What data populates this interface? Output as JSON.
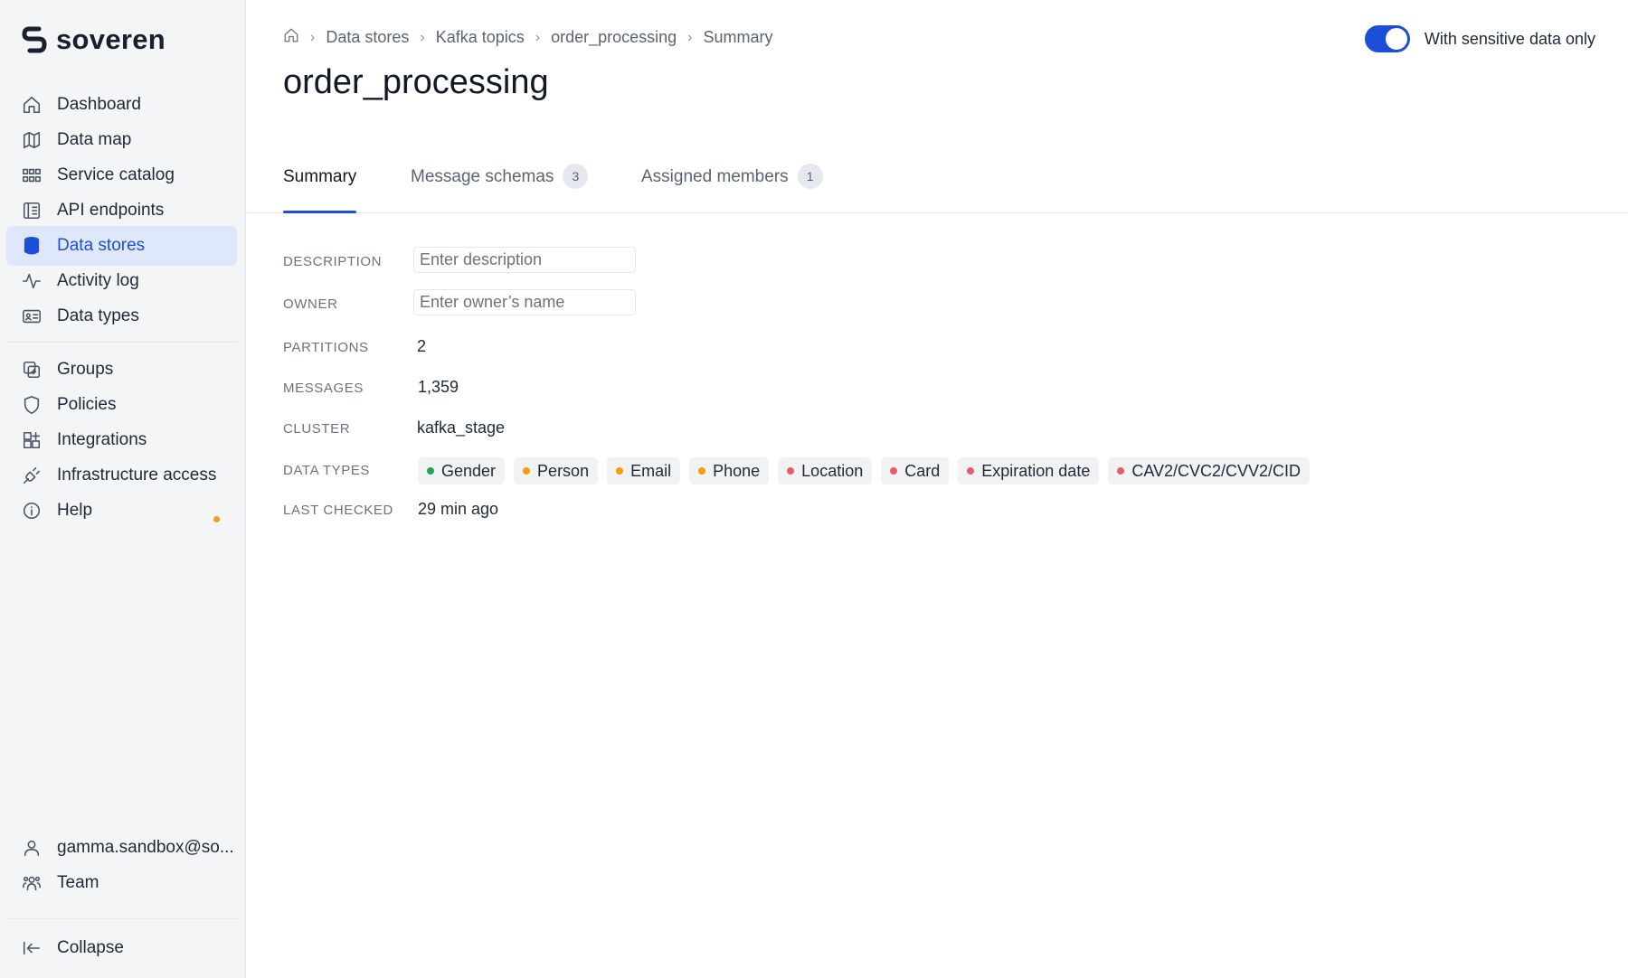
{
  "brand": {
    "name": "soveren"
  },
  "sidebar": {
    "items": [
      {
        "label": "Dashboard",
        "icon": "home-icon"
      },
      {
        "label": "Data map",
        "icon": "map-icon"
      },
      {
        "label": "Service catalog",
        "icon": "grid-icon"
      },
      {
        "label": "API endpoints",
        "icon": "api-icon"
      },
      {
        "label": "Data stores",
        "icon": "database-icon",
        "active": true
      },
      {
        "label": "Activity log",
        "icon": "activity-icon"
      },
      {
        "label": "Data types",
        "icon": "id-card-icon"
      },
      {
        "label": "Groups",
        "icon": "groups-icon"
      },
      {
        "label": "Policies",
        "icon": "shield-icon"
      },
      {
        "label": "Integrations",
        "icon": "integrations-icon"
      },
      {
        "label": "Infrastructure access",
        "icon": "plug-icon",
        "notify": true
      },
      {
        "label": "Help",
        "icon": "info-icon"
      }
    ],
    "user": {
      "label": "gamma.sandbox@so...",
      "icon": "user-icon"
    },
    "team": {
      "label": "Team",
      "icon": "team-icon"
    },
    "collapse": {
      "label": "Collapse",
      "icon": "collapse-icon"
    }
  },
  "breadcrumb": [
    "Data stores",
    "Kafka topics",
    "order_processing",
    "Summary"
  ],
  "page": {
    "title": "order_processing"
  },
  "toggle": {
    "label": "With sensitive data only",
    "on": true
  },
  "tabs": [
    {
      "label": "Summary",
      "active": true
    },
    {
      "label": "Message schemas",
      "count": "3"
    },
    {
      "label": "Assigned members",
      "count": "1"
    }
  ],
  "summary": {
    "description_label": "DESCRIPTION",
    "description_placeholder": "Enter description",
    "owner_label": "OWNER",
    "owner_placeholder": "Enter owner’s name",
    "partitions_label": "PARTITIONS",
    "partitions_value": "2",
    "messages_label": "MESSAGES",
    "messages_value": "1,359",
    "cluster_label": "CLUSTER",
    "cluster_value": "kafka_stage",
    "data_types_label": "DATA TYPES",
    "data_types": [
      {
        "name": "Gender",
        "color": "#22a55a"
      },
      {
        "name": "Person",
        "color": "#f59e0b"
      },
      {
        "name": "Email",
        "color": "#f59e0b"
      },
      {
        "name": "Phone",
        "color": "#f59e0b"
      },
      {
        "name": "Location",
        "color": "#ea5b6a"
      },
      {
        "name": "Card",
        "color": "#ea5b6a"
      },
      {
        "name": "Expiration date",
        "color": "#ea5b6a"
      },
      {
        "name": "CAV2/CVC2/CVV2/CID",
        "color": "#ea5b6a"
      }
    ],
    "last_checked_label": "LAST CHECKED",
    "last_checked_value": "29 min ago"
  },
  "colors": {
    "accent": "#1d4ed8",
    "active_bg": "#dfe8fb",
    "sidebar_bg": "#f4f5f7"
  }
}
